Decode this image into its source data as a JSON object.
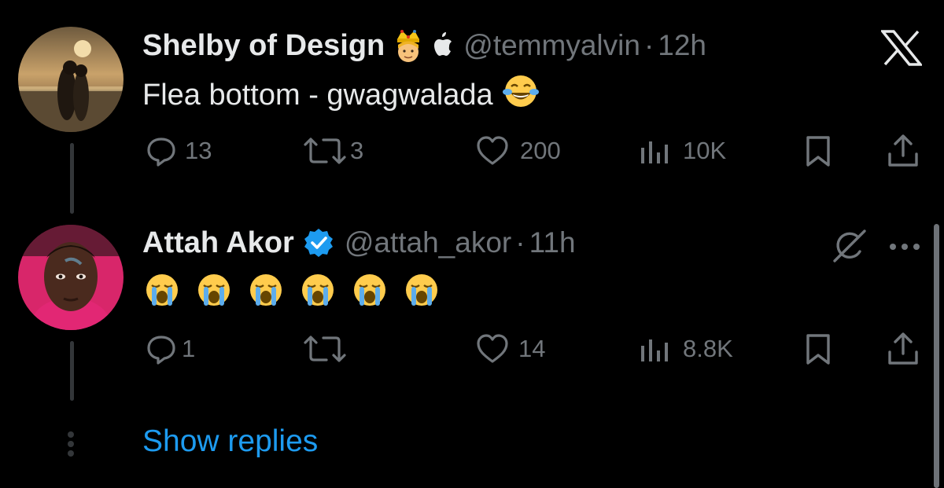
{
  "colors": {
    "background": "#000000",
    "text": "#e7e9ea",
    "secondary": "#71767b",
    "accent": "#1d9bf0",
    "thread_line": "#333639"
  },
  "tweet1": {
    "author_name": "Shelby of Design",
    "badges": [
      "prince-emoji",
      "apple-icon"
    ],
    "handle": "@temmyalvin",
    "separator": "·",
    "time": "12h",
    "text": "Flea bottom - gwagwalada",
    "text_emoji": "face-with-tears-of-joy",
    "menu_icon": "x-logo-icon",
    "actions": {
      "replies": "13",
      "reposts": "3",
      "likes": "200",
      "views": "10K"
    }
  },
  "tweet2": {
    "author_name": "Attah Akor",
    "badges": [
      "verified-badge-icon"
    ],
    "handle": "@attah_akor",
    "separator": "·",
    "time": "11h",
    "text_emojis": [
      "loudly-crying-face",
      "loudly-crying-face",
      "loudly-crying-face",
      "loudly-crying-face",
      "loudly-crying-face",
      "loudly-crying-face"
    ],
    "icons": [
      "grok-icon",
      "more-icon"
    ],
    "actions": {
      "replies": "1",
      "reposts": "",
      "likes": "14",
      "views": "8.8K"
    }
  },
  "show_replies_label": "Show replies"
}
